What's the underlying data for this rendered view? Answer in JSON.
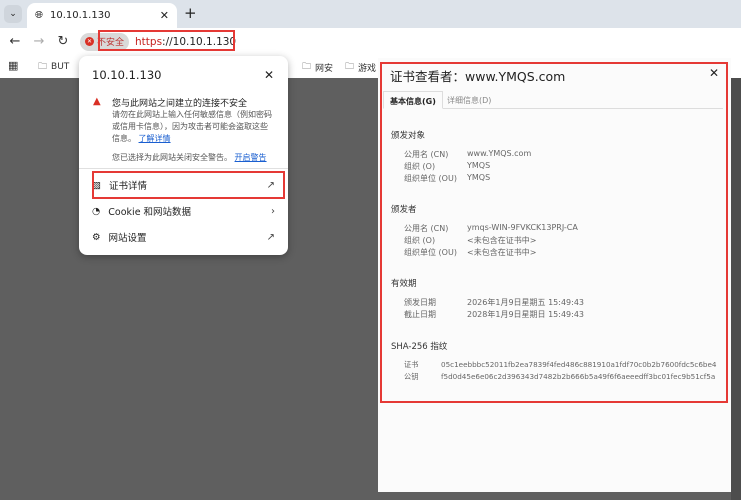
{
  "browser": {
    "tab_title": "10.10.1.130",
    "insecure_label": "不安全",
    "url_scheme": "https",
    "url_rest": "://10.10.1.130",
    "bookmarks": [
      "BUT",
      "网安",
      "游戏"
    ]
  },
  "popup": {
    "title": "10.10.1.130",
    "warning_title": "您与此网站之间建立的连接不安全",
    "warning_body": "请勿在此网站上输入任何敏感信息（例如密码或信用卡信息），因为攻击者可能会盗取这些信息。",
    "learn_more": "了解详情",
    "note": "您已选择为此网站关闭安全警告。",
    "enable_warnings": "开启警告",
    "items": [
      {
        "label": "证书详情"
      },
      {
        "label": "Cookie 和网站数据"
      },
      {
        "label": "网站设置"
      }
    ]
  },
  "viewer": {
    "title": "证书查看者：www.YMQS.com",
    "tabs": [
      "基本信息(G)",
      "详细信息(D)"
    ],
    "issued_to": {
      "heading": "颁发对象",
      "rows": [
        [
          "公用名 (CN)",
          "www.YMQS.com"
        ],
        [
          "组织 (O)",
          "YMQS"
        ],
        [
          "组织单位 (OU)",
          "YMQS"
        ]
      ]
    },
    "issued_by": {
      "heading": "颁发者",
      "rows": [
        [
          "公用名 (CN)",
          "ymqs-WIN-9FVKCK13PRJ-CA"
        ],
        [
          "组织 (O)",
          "<未包含在证书中>"
        ],
        [
          "组织单位 (OU)",
          "<未包含在证书中>"
        ]
      ]
    },
    "validity": {
      "heading": "有效期",
      "rows": [
        [
          "颁发日期",
          "2026年1月9日星期五 15:49:43"
        ],
        [
          "截止日期",
          "2028年1月9日星期日 15:49:43"
        ]
      ]
    },
    "fingerprints": {
      "heading": "SHA-256 指纹",
      "rows": [
        [
          "证书",
          "05c1eebbbc52011fb2ea7839f4fed486c881910a1fdf70c0b2b7600fdc5c6be4"
        ],
        [
          "公钥",
          "f5d0d45e6e06c2d396343d7482b2b666b5a49f6f6aeeedff3bc01fec9b51cf5a"
        ]
      ]
    }
  },
  "highlight_color": "#e53935"
}
